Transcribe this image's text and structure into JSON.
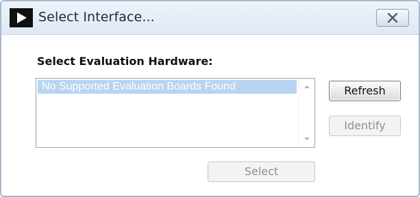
{
  "window": {
    "title": "Select Interface...",
    "logo_icon": "play-triangle-logo",
    "close_icon": "close-x-icon"
  },
  "dialog": {
    "section_label": "Select Evaluation Hardware:",
    "list": {
      "items": [
        "No Supported Evaluation Boards Found"
      ],
      "selected_index": 0
    },
    "buttons": {
      "refresh": "Refresh",
      "identify": "Identify",
      "select": "Select"
    }
  },
  "colors": {
    "titlebar": "#e6edf7",
    "selection": "#b7d4f3",
    "disabled_text": "#8c9095"
  }
}
